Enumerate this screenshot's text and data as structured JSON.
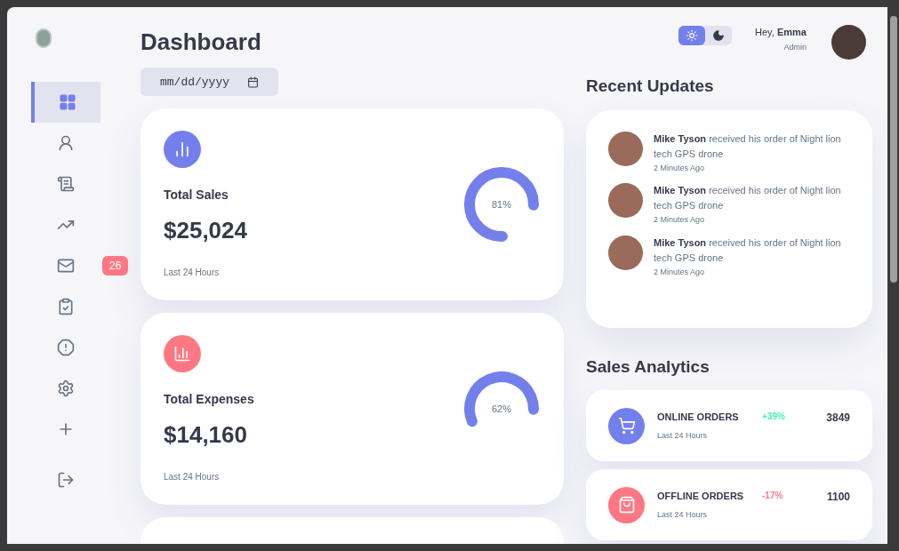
{
  "nav": [
    {
      "selected": true
    },
    {
      "selected": false
    },
    {
      "selected": false
    },
    {
      "selected": false
    },
    {
      "selected": false,
      "badge": "26"
    },
    {
      "selected": false
    },
    {
      "selected": false
    },
    {
      "selected": false
    },
    {
      "selected": false
    },
    {
      "selected": false
    }
  ],
  "title": "Dashboard",
  "date_field": {
    "placeholder": "mm/dd/yyyy"
  },
  "stat_cards": [
    {
      "color": "#7380ec",
      "label": "Total Sales",
      "amount": "$25,024",
      "percent": "81%",
      "level": 0.81,
      "period": "Last 24 Hours"
    },
    {
      "color": "#ff7782",
      "label": "Total Expenses",
      "amount": "$14,160",
      "percent": "62%",
      "level": 0.62,
      "period": "Last 24 Hours"
    }
  ],
  "theme_toggle": [
    {
      "selected": true
    },
    {
      "selected": false
    }
  ],
  "profile": {
    "greeting": "Hey,",
    "name": "Emma",
    "role": "Admin"
  },
  "recent_updates": {
    "title": "Recent Updates",
    "items": [
      {
        "name": "Mike Tyson",
        "message": "received his order of Night lion tech GPS drone",
        "time": "2 Minutes Ago"
      },
      {
        "name": "Mike Tyson",
        "message": "received his order of Night lion tech GPS drone",
        "time": "2 Minutes Ago"
      },
      {
        "name": "Mike Tyson",
        "message": "received his order of Night lion tech GPS drone",
        "time": "2 Minutes Ago"
      }
    ]
  },
  "sales_analytics": {
    "title": "Sales Analytics",
    "items": [
      {
        "color": "#7380ec",
        "label": "ONLINE ORDERS",
        "period": "Last 24 Hours",
        "change": {
          "text": "+39%",
          "color": "#41f1b6"
        },
        "value": "3849"
      },
      {
        "color": "#ff7782",
        "label": "OFFLINE ORDERS",
        "period": "Last 24 Hours",
        "change": {
          "text": "-17%",
          "color": "#ff7782"
        },
        "value": "1100"
      }
    ]
  }
}
